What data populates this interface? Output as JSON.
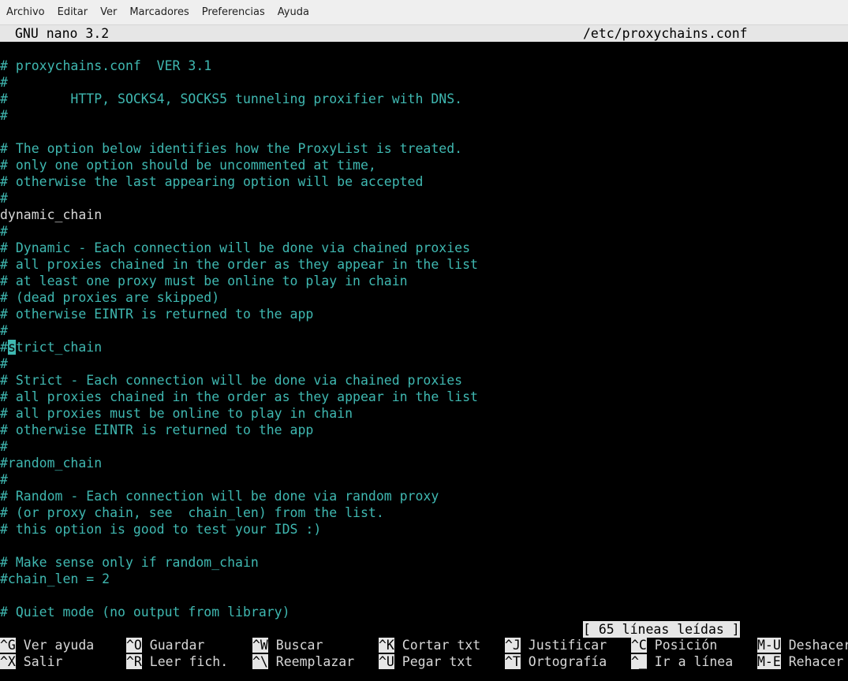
{
  "menu": [
    "Archivo",
    "Editar",
    "Ver",
    "Marcadores",
    "Preferencias",
    "Ayuda"
  ],
  "nano": {
    "title_left": "GNU nano 3.2",
    "title_right": "/etc/proxychains.conf"
  },
  "editor": {
    "lines": [
      {
        "text": "# proxychains.conf  VER 3.1",
        "kind": "comment"
      },
      {
        "text": "#",
        "kind": "comment"
      },
      {
        "text": "#        HTTP, SOCKS4, SOCKS5 tunneling proxifier with DNS.",
        "kind": "comment"
      },
      {
        "text": "#",
        "kind": "comment"
      },
      {
        "text": "",
        "kind": "comment"
      },
      {
        "text": "# The option below identifies how the ProxyList is treated.",
        "kind": "comment"
      },
      {
        "text": "# only one option should be uncommented at time,",
        "kind": "comment"
      },
      {
        "text": "# otherwise the last appearing option will be accepted",
        "kind": "comment"
      },
      {
        "text": "#",
        "kind": "comment"
      },
      {
        "text": "dynamic_chain",
        "kind": "plain"
      },
      {
        "text": "#",
        "kind": "comment"
      },
      {
        "text": "# Dynamic - Each connection will be done via chained proxies",
        "kind": "comment"
      },
      {
        "text": "# all proxies chained in the order as they appear in the list",
        "kind": "comment"
      },
      {
        "text": "# at least one proxy must be online to play in chain",
        "kind": "comment"
      },
      {
        "text": "# (dead proxies are skipped)",
        "kind": "comment"
      },
      {
        "text": "# otherwise EINTR is returned to the app",
        "kind": "comment"
      },
      {
        "text": "#",
        "kind": "comment"
      },
      {
        "text": "#strict_chain",
        "kind": "cursor"
      },
      {
        "text": "#",
        "kind": "comment"
      },
      {
        "text": "# Strict - Each connection will be done via chained proxies",
        "kind": "comment"
      },
      {
        "text": "# all proxies chained in the order as they appear in the list",
        "kind": "comment"
      },
      {
        "text": "# all proxies must be online to play in chain",
        "kind": "comment"
      },
      {
        "text": "# otherwise EINTR is returned to the app",
        "kind": "comment"
      },
      {
        "text": "#",
        "kind": "comment"
      },
      {
        "text": "#random_chain",
        "kind": "comment"
      },
      {
        "text": "#",
        "kind": "comment"
      },
      {
        "text": "# Random - Each connection will be done via random proxy",
        "kind": "comment"
      },
      {
        "text": "# (or proxy chain, see  chain_len) from the list.",
        "kind": "comment"
      },
      {
        "text": "# this option is good to test your IDS :)",
        "kind": "comment"
      },
      {
        "text": "",
        "kind": "comment"
      },
      {
        "text": "# Make sense only if random_chain",
        "kind": "comment"
      },
      {
        "text": "#chain_len = 2",
        "kind": "comment"
      },
      {
        "text": "",
        "kind": "comment"
      },
      {
        "text": "# Quiet mode (no output from library)",
        "kind": "comment"
      }
    ]
  },
  "status": "[ 65 líneas leídas ]",
  "shortcuts": {
    "row1": [
      {
        "key": "^G",
        "label": "Ver ayuda"
      },
      {
        "key": "^O",
        "label": "Guardar"
      },
      {
        "key": "^W",
        "label": "Buscar"
      },
      {
        "key": "^K",
        "label": "Cortar txt"
      },
      {
        "key": "^J",
        "label": "Justificar"
      },
      {
        "key": "^C",
        "label": "Posición"
      },
      {
        "key": "M-U",
        "label": "Deshacer"
      }
    ],
    "row2": [
      {
        "key": "^X",
        "label": "Salir"
      },
      {
        "key": "^R",
        "label": "Leer fich."
      },
      {
        "key": "^\\",
        "label": "Reemplazar"
      },
      {
        "key": "^U",
        "label": "Pegar txt"
      },
      {
        "key": "^T",
        "label": "Ortografía"
      },
      {
        "key": "^_",
        "label": "Ir a línea"
      },
      {
        "key": "M-E",
        "label": "Rehacer"
      }
    ]
  }
}
